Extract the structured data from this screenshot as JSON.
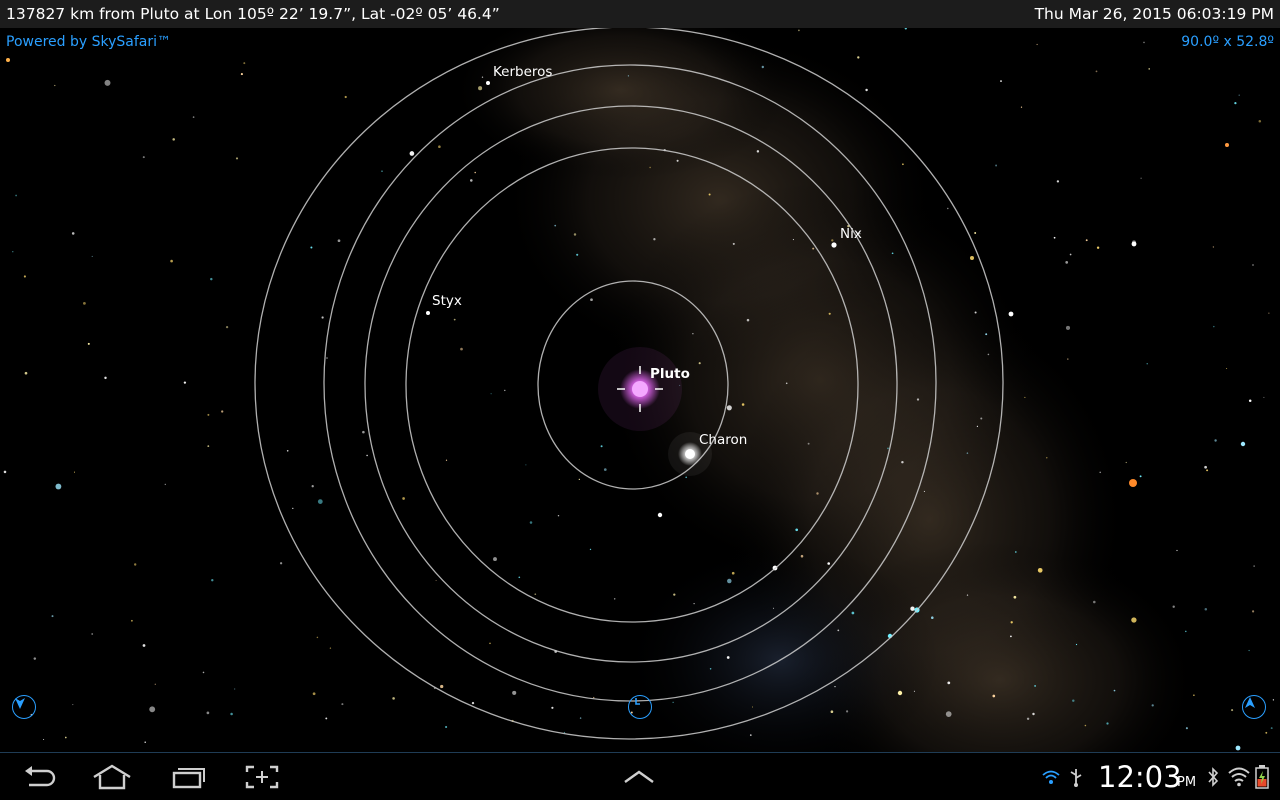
{
  "status": {
    "location": "137827 km from Pluto at Lon 105º 22’ 19.7”, Lat -02º 05’ 46.4”",
    "datetime": "Thu Mar 26, 2015  06:03:19 PM"
  },
  "overlay": {
    "powered_by": "Powered by SkySafari™",
    "field_of_view": "90.0º x 52.8º"
  },
  "sky": {
    "center_object": "Pluto",
    "moons": [
      "Charon",
      "Styx",
      "Nix",
      "Kerberos"
    ]
  },
  "controls": {
    "left": "compass-down-icon",
    "center": "clock-icon",
    "right": "compass-up-icon"
  },
  "nav": {
    "buttons": [
      "back-icon",
      "home-icon",
      "recent-apps-icon",
      "screenshot-icon",
      "menu-up-icon"
    ]
  },
  "system": {
    "time": "12:03",
    "ampm": "PM"
  },
  "colors": {
    "accent": "#2a9fff",
    "pluto": "#ef6cff",
    "orbit": "#cfcfcf"
  }
}
